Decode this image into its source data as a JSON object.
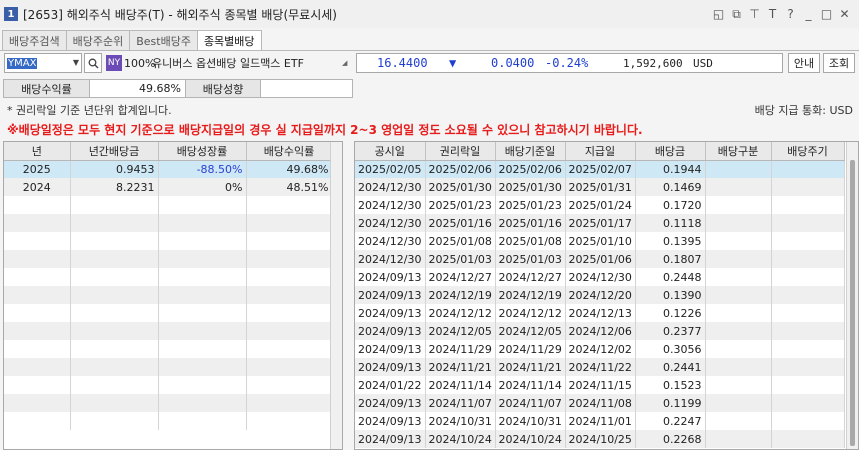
{
  "window": {
    "number": "1",
    "title": "[2653] 해외주식 배당주(T) - 해외주식 종목별 배당(무료시세)",
    "controls": [
      "restore-icon",
      "copy-icon",
      "pin-icon",
      "T",
      "?",
      "_",
      "□",
      "✕"
    ]
  },
  "tabs": [
    {
      "label": "배당주검색",
      "active": false
    },
    {
      "label": "배당주순위",
      "active": false
    },
    {
      "label": "Best배당주",
      "active": false
    },
    {
      "label": "종목별배당",
      "active": true
    }
  ],
  "quote": {
    "code": "YMAX",
    "market_badge": "NY",
    "percent": "100%",
    "name": "유니버스 옵션배당 일드맥스 ETF",
    "price": "16.4400",
    "arrow": "▼",
    "change": "0.0400",
    "change_pct": "-0.24%",
    "volume": "1,592,600",
    "currency": "USD",
    "btn_info": "안내",
    "btn_query": "조회"
  },
  "yield_row": {
    "yield_label": "배당수익률",
    "yield_value": "49.68%",
    "growth_label": "배당성향",
    "growth_value": ""
  },
  "notes": {
    "basis": "* 권리락일 기준 년단위 합계입니다.",
    "currency": "배당 지급 통화: USD",
    "warning": "※배당일정은 모두 현지 기준으로 배당지급일의 경우 실 지급일까지 2~3 영업일 정도 소요될 수 있으니 참고하시기 바랍니다."
  },
  "annual": {
    "headers": [
      "년",
      "년간배당금",
      "배당성장률",
      "배당수익률"
    ],
    "rows": [
      [
        "2025",
        "0.9453",
        "-88.50%",
        "49.68%"
      ],
      [
        "2024",
        "8.2231",
        "0%",
        "48.51%"
      ]
    ]
  },
  "history": {
    "headers": [
      "공시일",
      "권리락일",
      "배당기준일",
      "지급일",
      "배당금",
      "배당구분",
      "배당주기"
    ],
    "rows": [
      [
        "2025/02/05",
        "2025/02/06",
        "2025/02/06",
        "2025/02/07",
        "0.1944",
        "",
        ""
      ],
      [
        "2024/12/30",
        "2025/01/30",
        "2025/01/30",
        "2025/01/31",
        "0.1469",
        "",
        ""
      ],
      [
        "2024/12/30",
        "2025/01/23",
        "2025/01/23",
        "2025/01/24",
        "0.1720",
        "",
        ""
      ],
      [
        "2024/12/30",
        "2025/01/16",
        "2025/01/16",
        "2025/01/17",
        "0.1118",
        "",
        ""
      ],
      [
        "2024/12/30",
        "2025/01/08",
        "2025/01/08",
        "2025/01/10",
        "0.1395",
        "",
        ""
      ],
      [
        "2024/12/30",
        "2025/01/03",
        "2025/01/03",
        "2025/01/06",
        "0.1807",
        "",
        ""
      ],
      [
        "2024/09/13",
        "2024/12/27",
        "2024/12/27",
        "2024/12/30",
        "0.2448",
        "",
        ""
      ],
      [
        "2024/09/13",
        "2024/12/19",
        "2024/12/19",
        "2024/12/20",
        "0.1390",
        "",
        ""
      ],
      [
        "2024/09/13",
        "2024/12/12",
        "2024/12/12",
        "2024/12/13",
        "0.1226",
        "",
        ""
      ],
      [
        "2024/09/13",
        "2024/12/05",
        "2024/12/05",
        "2024/12/06",
        "0.2377",
        "",
        ""
      ],
      [
        "2024/09/13",
        "2024/11/29",
        "2024/11/29",
        "2024/12/02",
        "0.3056",
        "",
        ""
      ],
      [
        "2024/09/13",
        "2024/11/21",
        "2024/11/21",
        "2024/11/22",
        "0.2441",
        "",
        ""
      ],
      [
        "2024/01/22",
        "2024/11/14",
        "2024/11/14",
        "2024/11/15",
        "0.1523",
        "",
        ""
      ],
      [
        "2024/09/13",
        "2024/11/07",
        "2024/11/07",
        "2024/11/08",
        "0.1199",
        "",
        ""
      ],
      [
        "2024/09/13",
        "2024/10/31",
        "2024/10/31",
        "2024/11/01",
        "0.2247",
        "",
        ""
      ],
      [
        "2024/09/13",
        "2024/10/24",
        "2024/10/24",
        "2024/10/25",
        "0.2268",
        "",
        ""
      ]
    ]
  },
  "colors": {
    "accent": "#3469c6",
    "warning": "#e81b1b",
    "down": "#1f3fd0",
    "selected_row": "#cfe8f6"
  }
}
